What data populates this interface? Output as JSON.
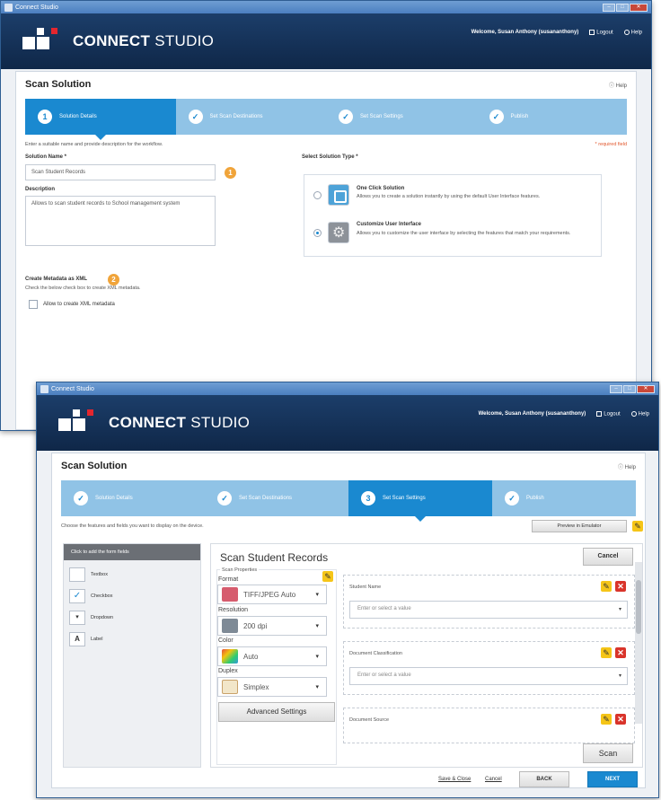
{
  "window_title": "Connect Studio",
  "brand": {
    "bold": "CONNECT",
    "light": "STUDIO"
  },
  "header": {
    "welcome": "Welcome, Susan Anthony (susananthony)",
    "logout": "Logout",
    "help": "Help"
  },
  "page_title": "Scan Solution",
  "help_link": "Help",
  "steps": [
    {
      "num": "1",
      "label": "Solution Details"
    },
    {
      "num": "2",
      "label": "Set Scan Destinations"
    },
    {
      "num": "3",
      "label": "Set Scan Settings"
    },
    {
      "num": "4",
      "label": "Publish"
    }
  ],
  "screen1": {
    "instructions": "Enter a suitable name and provide description for the workflow.",
    "required_note": "* required field",
    "solution_name_label": "Solution Name *",
    "solution_name_value": "Scan Student Records",
    "callout1": "1",
    "description_label": "Description",
    "description_value": "Allows to scan student records to School management system",
    "select_type_label": "Select Solution Type *",
    "type_one_click_title": "One Click Solution",
    "type_one_click_desc": "Allows you to create a solution instantly by using the default User Interface features.",
    "type_custom_title": "Customize User Interface",
    "type_custom_desc": "Allows you to customize the user interface by selecting the features that match your requirements.",
    "metadata_label": "Create Metadata as XML",
    "callout2": "2",
    "metadata_desc": "Check the below check box to create XML metadata.",
    "metadata_checkbox": "Allow to create XML metadata"
  },
  "screen2": {
    "instructions": "Choose the features and fields you want to display on the device.",
    "preview_button": "Preview in Emulator",
    "left_panel_header": "Click to add the form fields",
    "field_types": [
      "Textbox",
      "Checkbox",
      "Dropdown",
      "Label"
    ],
    "scan_title": "Scan Student Records",
    "cancel_button": "Cancel",
    "scan_properties_label": "Scan Properties",
    "format_label": "Format",
    "format_value": "TIFF/JPEG Auto",
    "resolution_label": "Resolution",
    "resolution_value": "200 dpi",
    "color_label": "Color",
    "color_value": "Auto",
    "duplex_label": "Duplex",
    "duplex_value": "Simplex",
    "advanced_button": "Advanced Settings",
    "fields": [
      {
        "label": "Student Name",
        "placeholder": "Enter or select a value"
      },
      {
        "label": "Document Classification",
        "placeholder": "Enter or select a value"
      },
      {
        "label": "Document Source",
        "placeholder": ""
      }
    ],
    "scan_button": "Scan",
    "save_close": "Save & Close",
    "cancel_link": "Cancel",
    "back_button": "BACK",
    "next_button": "NEXT"
  }
}
